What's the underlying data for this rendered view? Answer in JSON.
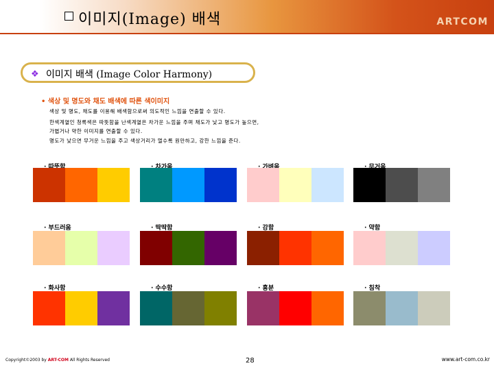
{
  "header": {
    "title": "이미지(Image) 배색",
    "brand": "ARTCOM",
    "bullet_icon": "checkbox-square-icon"
  },
  "subtitle": {
    "icon": "four-diamond-bullet-icon",
    "text": "이미지 배색 (Image Color Harmony)"
  },
  "section": {
    "heading": "• 색상 및 명도와 채도 배색에 따른 색이미지",
    "lines": [
      "색상 및 명도, 채도를 이용해 배색함으로써 의도적인 느낌을 연출할 수 있다.",
      "한색계열인 청록색은 따뜻함을 난색계열은 차가운 느낌을 주며 채도가 낮고 명도가 높으면,",
      "가볍거나 약한 이미지를 연출할 수 있다.",
      "명도가 낮으면 무거운 느낌을 주고 색상거리가 멀수록 원만하고, 강한 느낌을 준다."
    ]
  },
  "groups": [
    {
      "label": "· 따뜻함",
      "colors": [
        "#cc3300",
        "#ff6600",
        "#ffcc00"
      ]
    },
    {
      "label": "· 차가움",
      "colors": [
        "#008080",
        "#0099ff",
        "#0033cc"
      ]
    },
    {
      "label": "· 가벼움",
      "colors": [
        "#ffcccc",
        "#ffffbb",
        "#cce6ff"
      ]
    },
    {
      "label": "· 무거움",
      "colors": [
        "#000000",
        "#4d4d4d",
        "#808080"
      ]
    },
    {
      "label": "· 부드러움",
      "colors": [
        "#ffcc99",
        "#e6ffaa",
        "#eaccff"
      ]
    },
    {
      "label": "· 딱딱함",
      "colors": [
        "#800000",
        "#336600",
        "#660066"
      ]
    },
    {
      "label": "· 강함",
      "colors": [
        "#8b2000",
        "#ff3300",
        "#ff6600"
      ]
    },
    {
      "label": "· 약함",
      "colors": [
        "#ffcccc",
        "#dde0d0",
        "#ccccff"
      ]
    },
    {
      "label": "· 화사함",
      "colors": [
        "#ff3300",
        "#ffcc00",
        "#7030a0"
      ]
    },
    {
      "label": "· 수수함",
      "colors": [
        "#006666",
        "#666633",
        "#808000"
      ]
    },
    {
      "label": "· 흥분",
      "colors": [
        "#993366",
        "#ff0000",
        "#ff6600"
      ]
    },
    {
      "label": "· 침착",
      "colors": [
        "#8c8c6c",
        "#99bbcc",
        "#ccccbb"
      ]
    }
  ],
  "footer": {
    "copyright_prefix": "Copyright©2003 by ",
    "copyright_brand": "ART-COM",
    "copyright_suffix": " All Rights Reserved",
    "page_number": "28",
    "url": "www.art-com.co.kr"
  }
}
